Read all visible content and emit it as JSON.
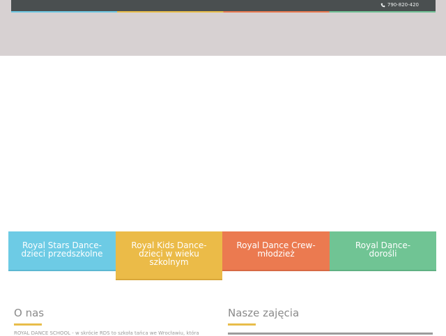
{
  "header": {
    "phone_icon": "phone-icon",
    "phone_number": "790-820-420"
  },
  "tiles": [
    {
      "label": "Royal Stars Dance- dzieci przedszkolne",
      "color": "#6dcbe5"
    },
    {
      "label": "Royal Kids Dance- dzieci w wieku szkolnym",
      "color": "#ebbb48"
    },
    {
      "label": "Royal Dance Crew- młodzież",
      "color": "#eb7a50"
    },
    {
      "label": "Royal Dance- dorośli",
      "color": "#70c494"
    }
  ],
  "about": {
    "title": "O nas",
    "text": "ROYAL DANCE SCHOOL - w skrócie RDS to szkoła tańca we Wrocławiu, która"
  },
  "classes": {
    "title": "Nasze zajęcia"
  }
}
